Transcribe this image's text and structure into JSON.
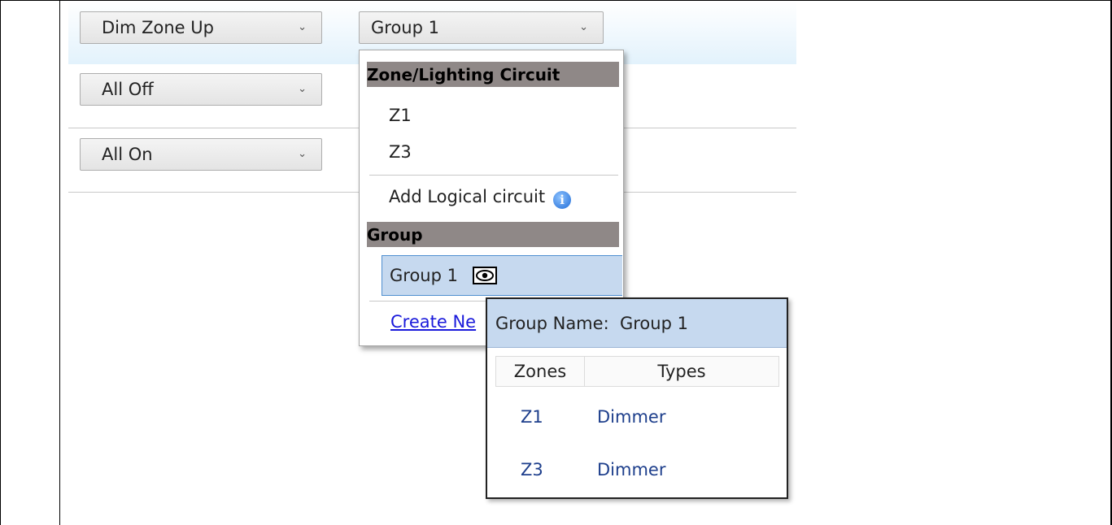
{
  "actions": [
    {
      "label": "Dim Zone Up"
    },
    {
      "label": "All Off"
    },
    {
      "label": "All On"
    }
  ],
  "target_select": {
    "value": "Group 1"
  },
  "dropdown": {
    "zone_header": "Zone/Lighting Circuit",
    "zones": [
      "Z1",
      "Z3"
    ],
    "add_logical": "Add Logical circuit",
    "group_header": "Group",
    "selected_group": "Group 1",
    "create_link": "Create Ne"
  },
  "group_popup": {
    "title": "Group Name:  Group 1",
    "columns": [
      "Zones",
      "Types"
    ],
    "rows": [
      {
        "zone": "Z1",
        "type": "Dimmer"
      },
      {
        "zone": "Z3",
        "type": "Dimmer"
      }
    ]
  },
  "colors": {
    "header_bg": "#8f8887",
    "selection_bg": "#c6d9ef",
    "link": "#1a1adb",
    "table_text": "#1e3f8c"
  },
  "icons": [
    "chevron-down-icon",
    "info-icon",
    "eye-icon"
  ]
}
